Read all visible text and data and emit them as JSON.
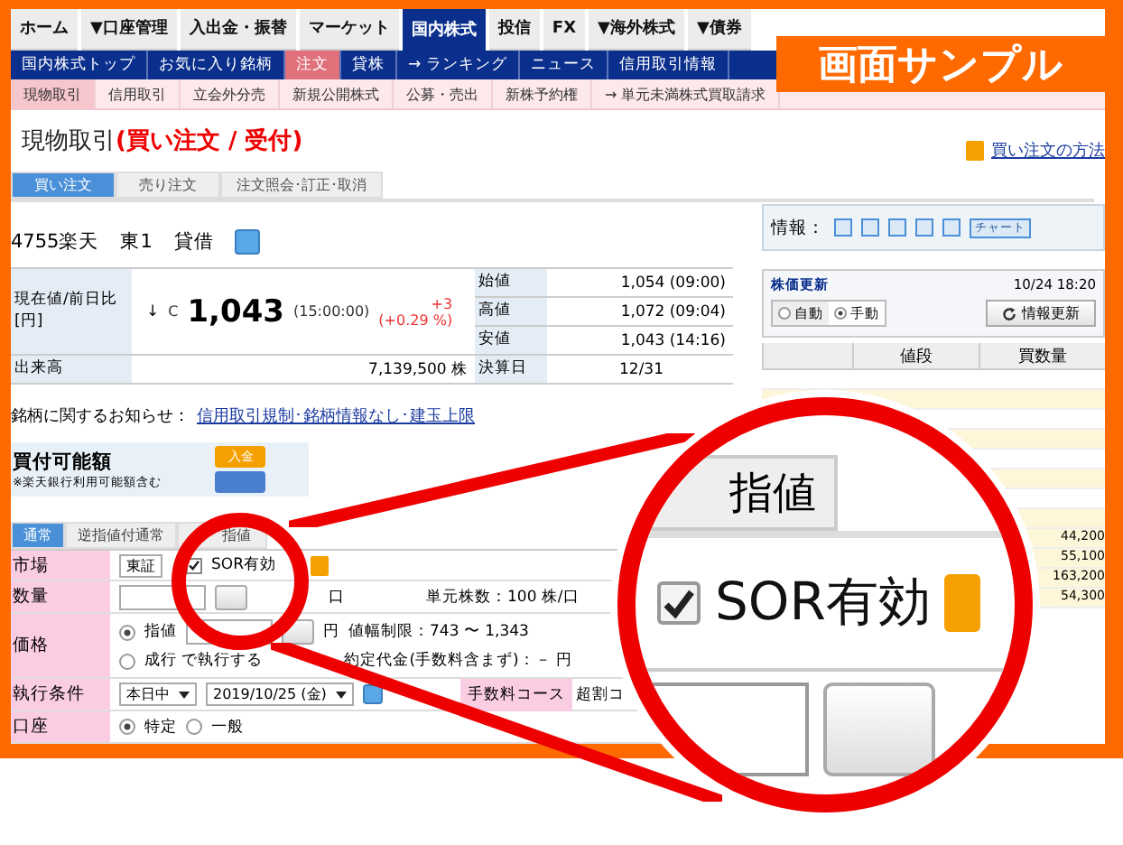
{
  "top_nav": [
    {
      "label": "ホーム",
      "selected": false
    },
    {
      "label": "▼口座管理",
      "selected": false
    },
    {
      "label": "入出金・振替",
      "selected": false
    },
    {
      "label": "マーケット",
      "selected": false
    },
    {
      "label": "国内株式",
      "selected": true
    },
    {
      "label": "投信",
      "selected": false
    },
    {
      "label": "FX",
      "selected": false
    },
    {
      "label": "▼海外株式",
      "selected": false
    },
    {
      "label": "▼債券",
      "selected": false
    }
  ],
  "badge": "画面サンプル",
  "sub_nav": [
    {
      "label": "国内株式トップ",
      "selected": false
    },
    {
      "label": "お気に入り銘柄",
      "selected": false
    },
    {
      "label": "注文",
      "selected": true
    },
    {
      "label": "貸株",
      "selected": false
    },
    {
      "label": "→ ランキング",
      "selected": false
    },
    {
      "label": "ニュース",
      "selected": false
    },
    {
      "label": "信用取引情報",
      "selected": false
    }
  ],
  "section_nav": [
    {
      "label": "現物取引",
      "selected": true
    },
    {
      "label": "信用取引",
      "selected": false
    },
    {
      "label": "立会外分売",
      "selected": false
    },
    {
      "label": "新規公開株式",
      "selected": false
    },
    {
      "label": "公募・売出",
      "selected": false
    },
    {
      "label": "新株予約権",
      "selected": false
    },
    {
      "label": "→ 単元未満株式買取請求",
      "selected": false
    }
  ],
  "page_title": {
    "text": "現物取引",
    "status": "(買い注文 / 受付)"
  },
  "help_link": "買い注文の方法",
  "order_tabs": [
    {
      "label": "買い注文",
      "selected": true
    },
    {
      "label": "売り注文",
      "selected": false
    },
    {
      "label": "注文照会･訂正･取消",
      "selected": false
    }
  ],
  "stock": {
    "code_name": "4755楽天",
    "market": "東1",
    "margin_type": "貸借"
  },
  "quote": {
    "label": "現在値/前日比[円]",
    "direction": "↓",
    "flag": "C",
    "price": "1,043",
    "time": "(15:00:00)",
    "change": "+3",
    "change_pct": "(+0.29 %)",
    "ohl": [
      {
        "label": "始値",
        "value": "1,054 (09:00)"
      },
      {
        "label": "高値",
        "value": "1,072 (09:04)"
      },
      {
        "label": "安値",
        "value": "1,043 (14:16)"
      }
    ],
    "volume_label": "出来高",
    "volume": "7,139,500 株",
    "settlement_label": "決算日",
    "settlement": "12/31"
  },
  "notice": {
    "label": "銘柄に関するお知らせ：",
    "link": "信用取引規制･銘柄情報なし･建玉上限"
  },
  "buying_power": {
    "title": "買付可能額",
    "note": "※楽天銀行利用可能額含む",
    "deposit_button": "入金"
  },
  "order_type_tabs": [
    {
      "label": "通常",
      "selected": true
    },
    {
      "label": "逆指値付通常",
      "selected": false
    },
    {
      "label": "指値",
      "selected": false
    }
  ],
  "form": {
    "market": {
      "label": "市場",
      "value": "東証",
      "sor_label": "SOR有効",
      "sor_checked": true
    },
    "quantity": {
      "label": "数量",
      "unit": "口",
      "lot": "単元株数：100 株/口"
    },
    "price": {
      "label": "価格",
      "options": [
        {
          "label": "指値",
          "selected": true
        },
        {
          "label": "成行 で執行する",
          "selected": false
        }
      ],
      "unit": "円",
      "limit": "値幅制限：743 〜 1,343",
      "estimate": "約定代金(手数料含まず)：－ 円"
    },
    "condition": {
      "label": "執行条件",
      "period": "本日中",
      "date": "2019/10/25 (金)",
      "fee_label": "手数料コース",
      "fee_value": "超割コ"
    },
    "account": {
      "label": "口座",
      "options": [
        {
          "label": "特定",
          "selected": true
        },
        {
          "label": "一般",
          "selected": false
        }
      ]
    }
  },
  "info_bar": {
    "label": "情報：",
    "chart_button": "チャート"
  },
  "price_update": {
    "title": "株価更新",
    "timestamp": "10/24 18:20",
    "modes": [
      {
        "label": "自動",
        "selected": false
      },
      {
        "label": "手動",
        "selected": true
      }
    ],
    "refresh_button": "情報更新"
  },
  "board": {
    "columns": [
      "値段",
      "買数量"
    ],
    "quantities": [
      "44,200",
      "55,100",
      "163,200",
      "54,300"
    ]
  },
  "magnifier": {
    "tab": "指値",
    "sor_label": "SOR有効",
    "sor_checked": true
  }
}
